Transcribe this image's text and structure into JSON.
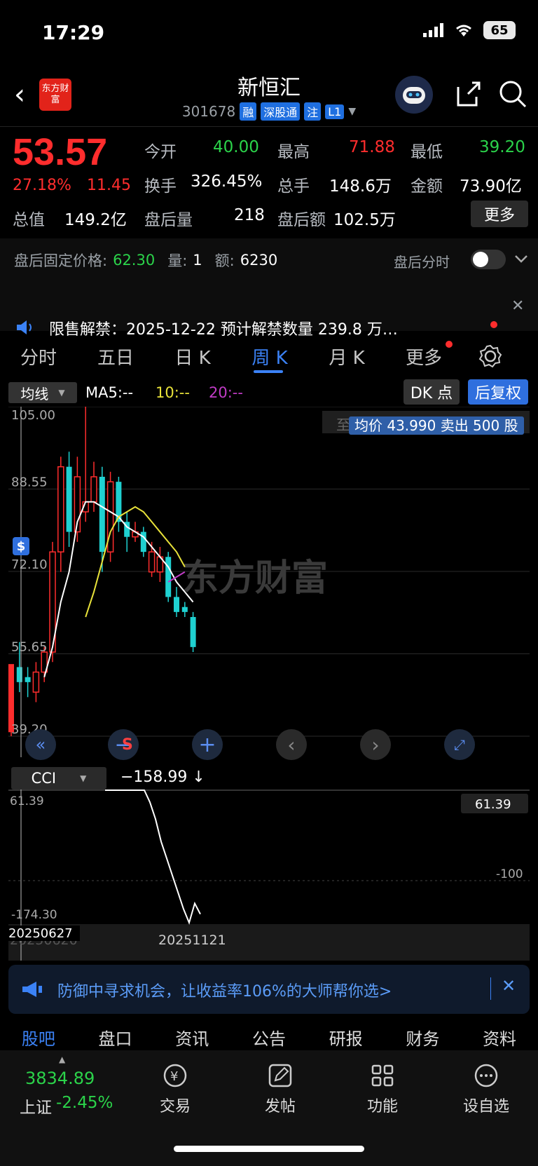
{
  "status": {
    "time": "17:29",
    "battery": "65"
  },
  "header": {
    "logo_text": "东方财富",
    "title": "新恒汇",
    "code": "301678",
    "tags": [
      "融",
      "深股通",
      "注",
      "L1"
    ]
  },
  "quote": {
    "price": "53.57",
    "change_pct": "27.18%",
    "change": "11.45",
    "open_label": "今开",
    "open": "40.00",
    "high_label": "最高",
    "high": "71.88",
    "low_label": "最低",
    "low": "39.20",
    "turnover_label": "换手",
    "turnover": "326.45%",
    "volume_label": "总手",
    "volume": "148.6万",
    "amount_label": "金额",
    "amount": "73.90亿",
    "mktcap_label": "总值",
    "mktcap": "149.2亿",
    "after_vol_label": "盘后量",
    "after_vol": "218",
    "after_amt_label": "盘后额",
    "after_amt": "102.5万",
    "more_label": "更多"
  },
  "after_hours": {
    "fixed_price_label": "盘后固定价格:",
    "fixed_price": "62.30",
    "qty_label": "量:",
    "qty": "1",
    "amt_label": "额:",
    "amt": "6230",
    "toggle_label": "盘后分时"
  },
  "notice": {
    "text": "限售解禁：2025-12-22 预计解禁数量 239.8 万…"
  },
  "tabs": [
    "分时",
    "五日",
    "日 K",
    "周 K",
    "月 K",
    "更多"
  ],
  "active_tab": 3,
  "chart_controls": {
    "ma_dropdown": "均线",
    "ma5": "MA5:--",
    "ma10": "10:--",
    "ma20": "20:--",
    "dk_label": "DK 点",
    "hfq_label": "后复权",
    "tooltip": "均价 43.990 卖出 500 股",
    "tooltip_behind": "至今涨幅",
    "watermark": "东方财富",
    "s_marker": "S"
  },
  "cci": {
    "dropdown": "CCI",
    "value": "−158.99 ↓",
    "axis_top": "61.39",
    "axis_bottom": "-174.30",
    "ref_line": "-100",
    "badge": "61.39",
    "date_left": "20250627",
    "date_left_behind": "20250620",
    "date_right": "20251121"
  },
  "chart_data": {
    "type": "candlestick",
    "ylim": [
      39.2,
      105.0
    ],
    "y_ticks": [
      105.0,
      88.55,
      72.1,
      55.65,
      39.2
    ],
    "candles": [
      {
        "o": 40.0,
        "h": 53.0,
        "l": 39.2,
        "c": 53.6,
        "color": "up_hollow"
      },
      {
        "o": 53.0,
        "h": 58.0,
        "l": 48.0,
        "c": 50.0,
        "color": "down"
      },
      {
        "o": 50.0,
        "h": 53.0,
        "l": 47.0,
        "c": 51.0,
        "color": "down"
      },
      {
        "o": 48.0,
        "h": 54.0,
        "l": 46.0,
        "c": 52.0,
        "color": "up"
      },
      {
        "o": 52.0,
        "h": 57.0,
        "l": 50.0,
        "c": 56.0,
        "color": "up"
      },
      {
        "o": 56.0,
        "h": 78.0,
        "l": 54.0,
        "c": 76.0,
        "color": "up"
      },
      {
        "o": 76.0,
        "h": 95.0,
        "l": 72.0,
        "c": 93.0,
        "color": "up"
      },
      {
        "o": 93.0,
        "h": 96.0,
        "l": 77.0,
        "c": 80.0,
        "color": "down"
      },
      {
        "o": 80.0,
        "h": 95.0,
        "l": 78.0,
        "c": 91.0,
        "color": "up"
      },
      {
        "o": 84.0,
        "h": 106.0,
        "l": 82.0,
        "c": 86.0,
        "color": "up"
      },
      {
        "o": 86.0,
        "h": 94.0,
        "l": 84.0,
        "c": 91.0,
        "color": "up"
      },
      {
        "o": 91.0,
        "h": 93.0,
        "l": 72.0,
        "c": 76.0,
        "color": "down"
      },
      {
        "o": 76.0,
        "h": 92.0,
        "l": 74.0,
        "c": 90.0,
        "color": "up"
      },
      {
        "o": 90.0,
        "h": 91.0,
        "l": 80.0,
        "c": 82.0,
        "color": "down"
      },
      {
        "o": 82.0,
        "h": 84.0,
        "l": 76.0,
        "c": 79.0,
        "color": "down"
      },
      {
        "o": 79.0,
        "h": 82.0,
        "l": 78.0,
        "c": 80.0,
        "color": "up"
      },
      {
        "o": 80.0,
        "h": 81.0,
        "l": 75.0,
        "c": 76.0,
        "color": "down"
      },
      {
        "o": 76.0,
        "h": 78.0,
        "l": 71.0,
        "c": 72.0,
        "color": "up"
      },
      {
        "o": 72.0,
        "h": 77.0,
        "l": 70.0,
        "c": 75.0,
        "color": "up"
      },
      {
        "o": 75.0,
        "h": 76.0,
        "l": 66.0,
        "c": 67.0,
        "color": "down"
      },
      {
        "o": 67.0,
        "h": 69.0,
        "l": 63.0,
        "c": 64.0,
        "color": "down"
      },
      {
        "o": 64.0,
        "h": 66.0,
        "l": 63.0,
        "c": 65.0,
        "color": "down"
      },
      {
        "o": 63.0,
        "h": 64.0,
        "l": 56.0,
        "c": 57.0,
        "color": "down"
      }
    ],
    "ma5": [
      null,
      null,
      null,
      null,
      51.0,
      57.0,
      66.0,
      72.0,
      82.0,
      86.0,
      86.0,
      85.0,
      84.0,
      83.0,
      81.0,
      80.0,
      79.0,
      77.0,
      75.0,
      73.0,
      70.0,
      68.0,
      66.0
    ],
    "ma10": [
      null,
      null,
      null,
      null,
      null,
      null,
      null,
      null,
      null,
      63.0,
      68.0,
      74.0,
      80.0,
      83.0,
      84.0,
      85.0,
      84.0,
      82.0,
      80.0,
      78.0,
      76.0,
      73.0,
      null
    ],
    "ma20": [
      null,
      null,
      null,
      null,
      null,
      null,
      null,
      null,
      null,
      null,
      null,
      null,
      null,
      null,
      null,
      null,
      null,
      null,
      null,
      70.0,
      71.0,
      72.0,
      null
    ],
    "cci": [
      200,
      190,
      170,
      140,
      110,
      90,
      70,
      61.39,
      40,
      10,
      -30,
      -60,
      -90,
      -120,
      -150,
      -174.3,
      -140,
      -158.99
    ]
  },
  "promo": {
    "text": "防御中寻求机会，让收益率106%的大师帮你选>"
  },
  "subtabs": [
    "股吧",
    "盘口",
    "资讯",
    "公告",
    "研报",
    "财务",
    "资料"
  ],
  "bottom_nav": {
    "index_value": "3834.89",
    "index_label": "上证",
    "index_change": "-2.45%",
    "items": [
      "交易",
      "发帖",
      "功能",
      "设自选"
    ]
  },
  "colors": {
    "up": "#ff2d2d",
    "down": "#1fd1d1",
    "accent": "#3b82f6",
    "ma5": "#ffffff",
    "ma10": "#e8e23a",
    "ma20": "#c13cc6"
  }
}
